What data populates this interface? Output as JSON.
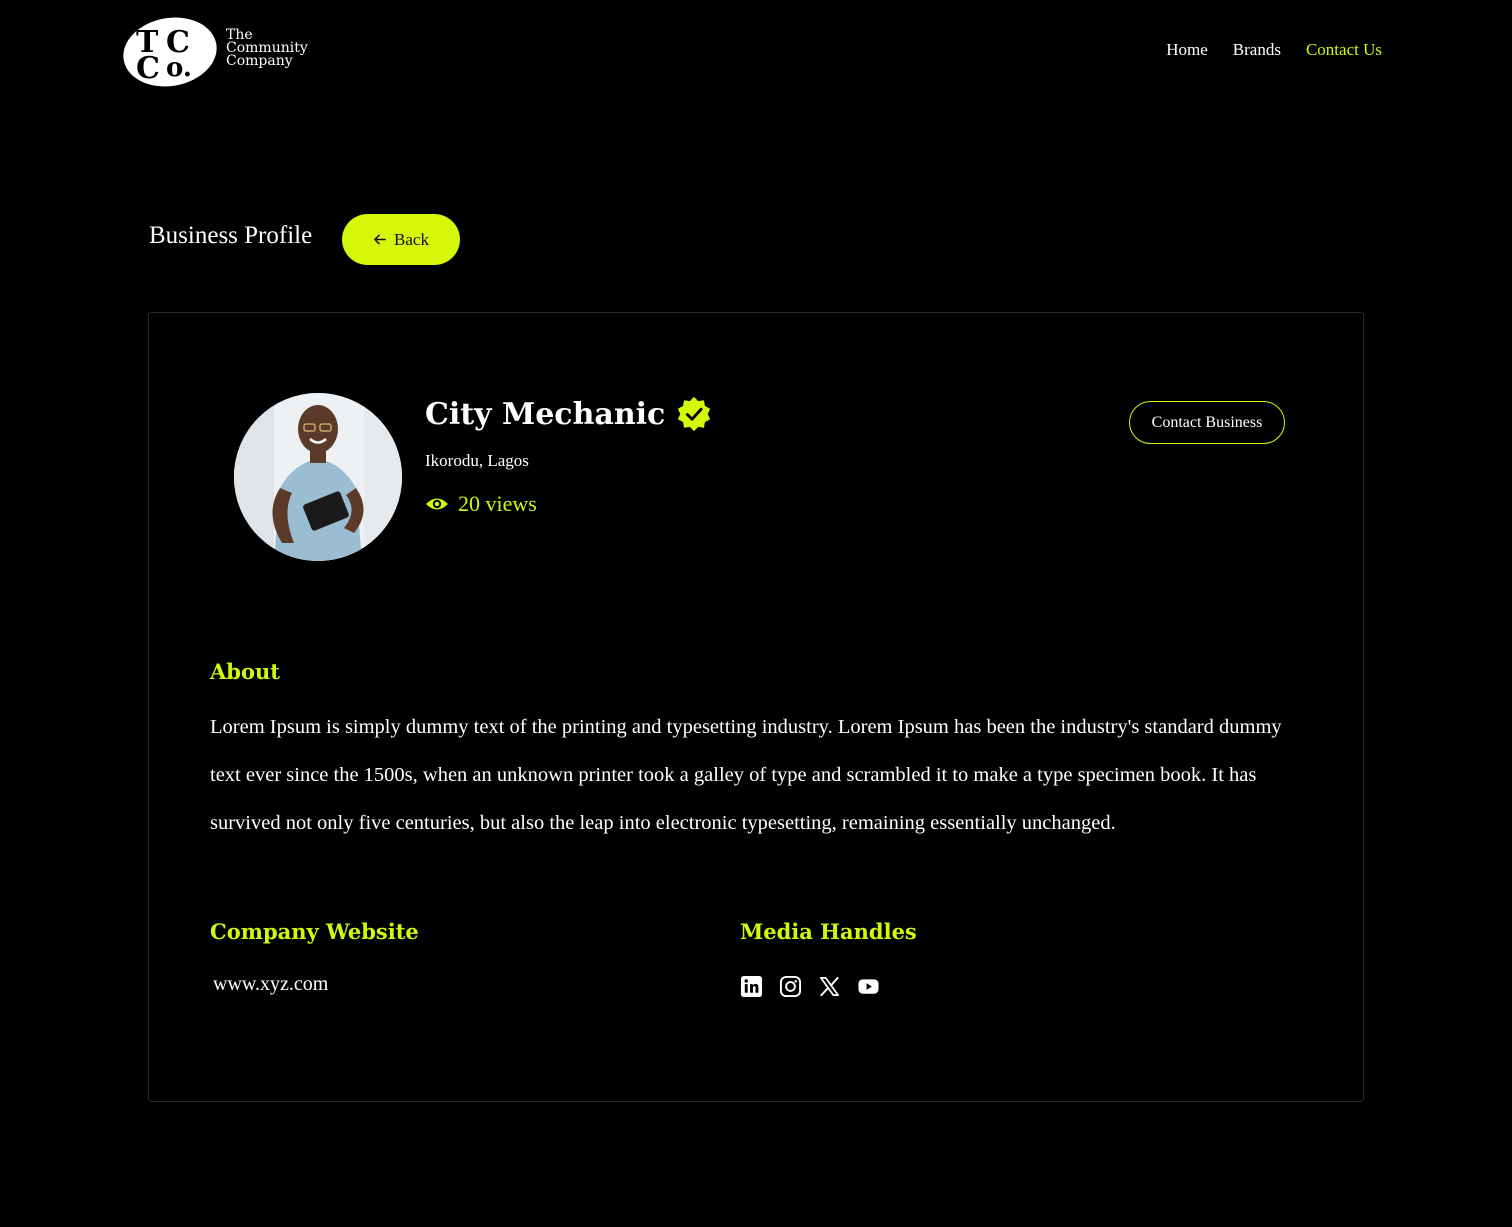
{
  "brand": {
    "monogram": "TCCo",
    "name_lines": [
      "The",
      "Community",
      "Company"
    ]
  },
  "nav": {
    "items": [
      {
        "label": "Home",
        "active": false
      },
      {
        "label": "Brands",
        "active": false
      },
      {
        "label": "Contact Us",
        "active": true
      }
    ]
  },
  "page": {
    "title": "Business Profile",
    "back_label": "Back"
  },
  "profile": {
    "name": "City Mechanic",
    "verified": true,
    "location": "Ikorodu, Lagos",
    "views": "20 views",
    "contact_label": "Contact Business"
  },
  "about": {
    "heading": "About",
    "text": "Lorem Ipsum is simply dummy text of the printing and typesetting industry. Lorem Ipsum has been the industry's standard dummy text ever since the 1500s, when an unknown printer took a galley of type and scrambled it to make a type specimen book. It has survived not only five centuries, but also the leap into electronic typesetting, remaining essentially unchanged."
  },
  "website": {
    "heading": "Company Website",
    "url": "www.xyz.com"
  },
  "media": {
    "heading": "Media Handles",
    "icons": [
      "linkedin-icon",
      "instagram-icon",
      "x-icon",
      "youtube-icon"
    ]
  },
  "colors": {
    "accent": "#d4f70a",
    "background": "#000000",
    "text": "#ffffff"
  }
}
